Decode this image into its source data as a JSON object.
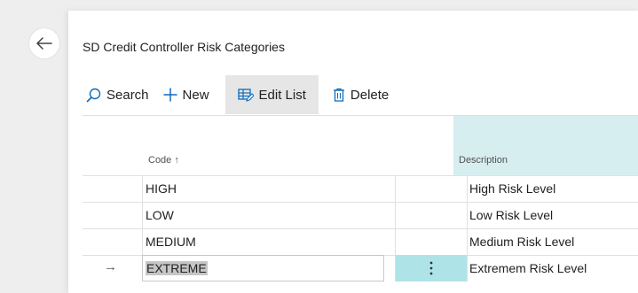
{
  "page": {
    "title": "SD Credit Controller Risk Categories"
  },
  "actions": {
    "search": "Search",
    "new": "New",
    "edit_list": "Edit List",
    "delete": "Delete"
  },
  "table": {
    "columns": {
      "code": "Code",
      "code_sort_indicator": "↑",
      "description": "Description"
    },
    "rows": [
      {
        "code": "HIGH",
        "description": "High Risk Level"
      },
      {
        "code": "LOW",
        "description": "Low Risk Level"
      },
      {
        "code": "MEDIUM",
        "description": "Medium Risk Level"
      },
      {
        "code": "EXTREME",
        "description": "Extremem Risk Level",
        "current": true,
        "editing": true
      }
    ],
    "current_row_indicator": "→"
  },
  "colors": {
    "accent_column_header": "#d7eef0",
    "accent_active_cell": "#aee3e8",
    "icon_blue": "#0f6cbd",
    "text_selection": "#c6c6c6"
  },
  "icons": [
    "back-arrow-icon",
    "search-icon",
    "plus-icon",
    "edit-list-icon",
    "trash-icon",
    "more-vertical-icon",
    "row-indicator-arrow-icon"
  ]
}
